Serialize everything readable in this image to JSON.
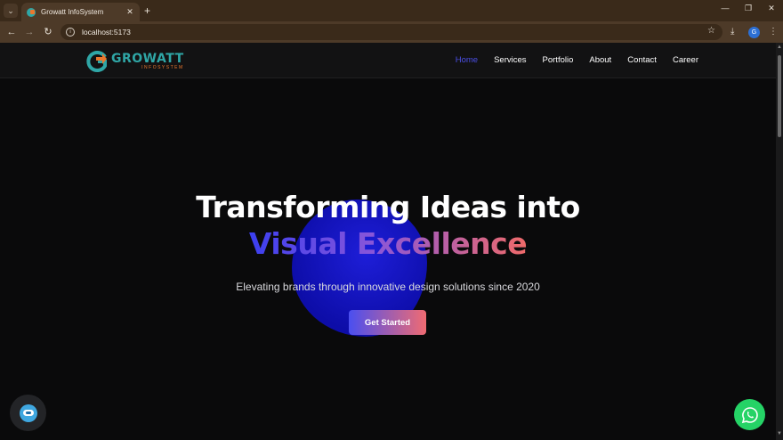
{
  "browser": {
    "tab_title": "Growatt InfoSystem",
    "tab_close": "✕",
    "new_tab": "+",
    "url": "localhost:5173",
    "profile_initial": "G",
    "controls": {
      "minimize": "—",
      "restore": "❐",
      "close": "✕"
    }
  },
  "site": {
    "logo": {
      "word": "GROWATT",
      "sub": "INFOSYSTEM",
      "colors": {
        "teal": "#2fa6a6",
        "orange": "#e9772e"
      }
    },
    "nav": [
      {
        "label": "Home",
        "active": true
      },
      {
        "label": "Services"
      },
      {
        "label": "Portfolio"
      },
      {
        "label": "About"
      },
      {
        "label": "Contact"
      },
      {
        "label": "Career"
      }
    ],
    "hero": {
      "line1": "Transforming Ideas into",
      "line2": "Visual Excellence",
      "subtitle": "Elevating brands through innovative design solutions since 2020",
      "cta": "Get Started"
    },
    "accent_colors": {
      "active_nav": "#4b4fe6",
      "gradient_start": "#3b3ff0",
      "gradient_end": "#ef6a6a",
      "whatsapp": "#25d366"
    },
    "floating": {
      "chat_icon": "chatbot-icon",
      "whatsapp_icon": "whatsapp-icon"
    }
  }
}
